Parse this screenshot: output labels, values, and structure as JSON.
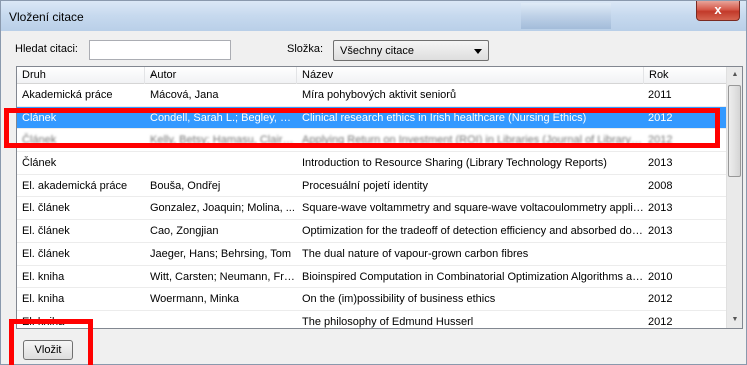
{
  "window": {
    "title": "Vložení citace",
    "close_label": "x"
  },
  "search": {
    "label": "Hledat citaci:",
    "value": "",
    "placeholder": ""
  },
  "folder": {
    "label": "Složka:",
    "selected": "Všechny citace"
  },
  "table": {
    "columns": [
      "Druh",
      "Autor",
      "Název",
      "Rok"
    ],
    "sort_column": "Autor",
    "rows": [
      {
        "type": "Akademická práce",
        "author": "Mácová, Jana",
        "title": "Míra pohybových aktivit seniorů",
        "year": "2011"
      },
      {
        "type": "Článek",
        "author": "Condell, Sarah L.; Begley, C...",
        "title": "Clinical research ethics in Irish healthcare (Nursing Ethics)",
        "year": "2012",
        "selected": true
      },
      {
        "type": "Článek",
        "author": "Kelly, Betsy; Hamasu, Claire;...",
        "title": "Applying Return on Investment (ROI) in Libraries (Journal of Library Administr...",
        "year": "2012",
        "obscured": true
      },
      {
        "type": "Článek",
        "author": "",
        "title": "Introduction to Resource Sharing (Library Technology Reports)",
        "year": "2013"
      },
      {
        "type": "El. akademická práce",
        "author": "Bouša, Ondřej",
        "title": "Procesuální pojetí identity",
        "year": "2008"
      },
      {
        "type": "El. článek",
        "author": "Gonzalez, Joaquin; Molina, ...",
        "title": "Square-wave voltammetry and square-wave voltacoulommetry applied to the...",
        "year": "2013"
      },
      {
        "type": "El. článek",
        "author": "Cao, Zongjian",
        "title": "Optimization for the tradeoff of detection efficiency and absorbed dose in x-r...",
        "year": "2013"
      },
      {
        "type": "El. článek",
        "author": "Jaeger, Hans; Behrsing, Tom",
        "title": "The dual nature of vapour-grown carbon fibres",
        "year": ""
      },
      {
        "type": "El. kniha",
        "author": "Witt, Carsten; Neumann, Fra...",
        "title": "Bioinspired Computation in Combinatorial Optimization Algorithms and Their C...",
        "year": "2010"
      },
      {
        "type": "El. kniha",
        "author": "Woermann, Minka",
        "title": "On the (im)possibility of business ethics",
        "year": "2012"
      },
      {
        "type": "El. kniha",
        "author": "",
        "title": "The philosophy of Edmund Husserl",
        "year": "2012"
      }
    ]
  },
  "footer": {
    "insert_label": "Vložit"
  },
  "colors": {
    "selection": "#3399ff",
    "highlight_box": "#ff0000"
  },
  "icons": {
    "close": "close-icon",
    "sort": "sort-ascending-icon",
    "dropdown": "chevron-down-icon"
  }
}
